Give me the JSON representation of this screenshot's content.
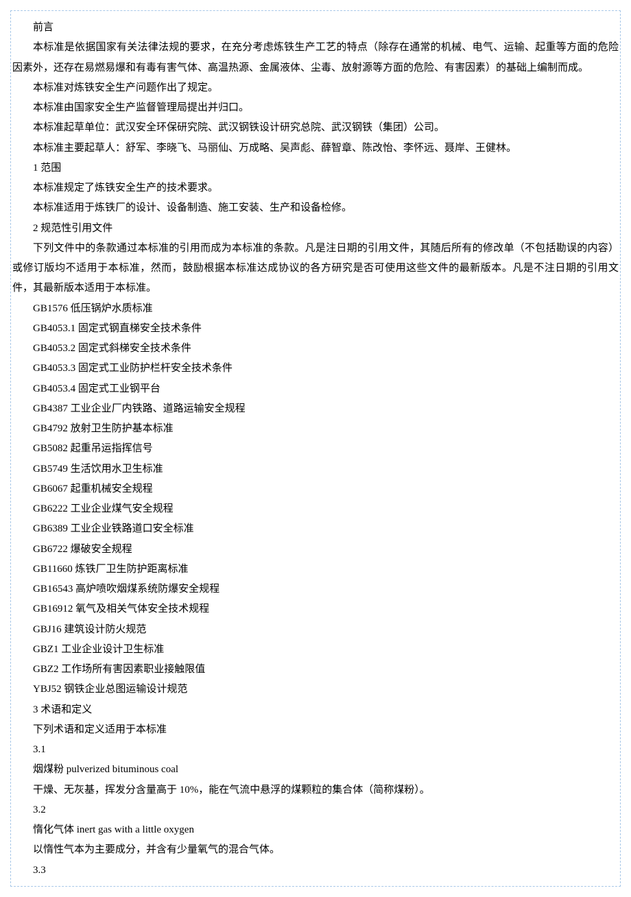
{
  "preface": {
    "title": "前言",
    "p1": "本标准是依据国家有关法律法规的要求，在充分考虑炼铁生产工艺的特点（除存在通常的机械、电气、运输、起重等方面的危险因素外，还存在易燃易爆和有毒有害气体、高温热源、金属液体、尘毒、放射源等方面的危险、有害因素）的基础上编制而成。",
    "p2": "本标准对炼铁安全生产问题作出了规定。",
    "p3": "本标准由国家安全生产监督管理局提出并归口。",
    "p4": "本标准起草单位：武汉安全环保研究院、武汉钢铁设计研究总院、武汉钢铁（集团）公司。",
    "p5": "本标准主要起草人：舒军、李晓飞、马丽仙、万成略、吴声彪、薛智章、陈改怡、李怀远、聂岸、王健林。"
  },
  "s1": {
    "heading": "1 范围",
    "p1": "本标准规定了炼铁安全生产的技术要求。",
    "p2": "本标准适用于炼铁厂的设计、设备制造、施工安装、生产和设备检修。"
  },
  "s2": {
    "heading": "2 规范性引用文件",
    "intro": "下列文件中的条款通过本标准的引用而成为本标准的条款。凡是注日期的引用文件，其随后所有的修改单（不包括勘误的内容）或修订版均不适用于本标准，然而，鼓励根据本标准达成协议的各方研究是否可使用这些文件的最新版本。凡是不注日期的引用文件，其最新版本适用于本标准。",
    "refs": [
      "GB1576 低压锅炉水质标准",
      "GB4053.1 固定式钢直梯安全技术条件",
      "GB4053.2 固定式斜梯安全技术条件",
      "GB4053.3 固定式工业防护栏杆安全技术条件",
      "GB4053.4 固定式工业钢平台",
      "GB4387 工业企业厂内铁路、道路运输安全规程",
      "GB4792 放射卫生防护基本标准",
      "GB5082 起重吊运指挥信号",
      "GB5749 生活饮用水卫生标准",
      "GB6067 起重机械安全规程",
      "GB6222 工业企业煤气安全规程",
      "GB6389 工业企业铁路道口安全标准",
      "GB6722 爆破安全规程",
      "GB11660 炼铁厂卫生防护距离标准",
      "GB16543 高炉喷吹烟煤系统防爆安全规程",
      "GB16912 氧气及相关气体安全技术规程",
      "GBJ16 建筑设计防火规范",
      "GBZ1 工业企业设计卫生标准",
      "GBZ2 工作场所有害因素职业接触限值",
      "YBJ52 钢铁企业总图运输设计规范"
    ]
  },
  "s3": {
    "heading": "3 术语和定义",
    "intro": "下列术语和定义适用于本标准",
    "t31_num": "3.1",
    "t31_term": "烟煤粉 pulverized bituminous coal",
    "t31_def": "干燥、无灰基，挥发分含量高于 10%，能在气流中悬浮的煤颗粒的集合体（简称煤粉）。",
    "t32_num": "3.2",
    "t32_term": "惰化气体 inert gas with a little oxygen",
    "t32_def": "以惰性气本为主要成分，并含有少量氧气的混合气体。",
    "t33_num": "3.3"
  }
}
